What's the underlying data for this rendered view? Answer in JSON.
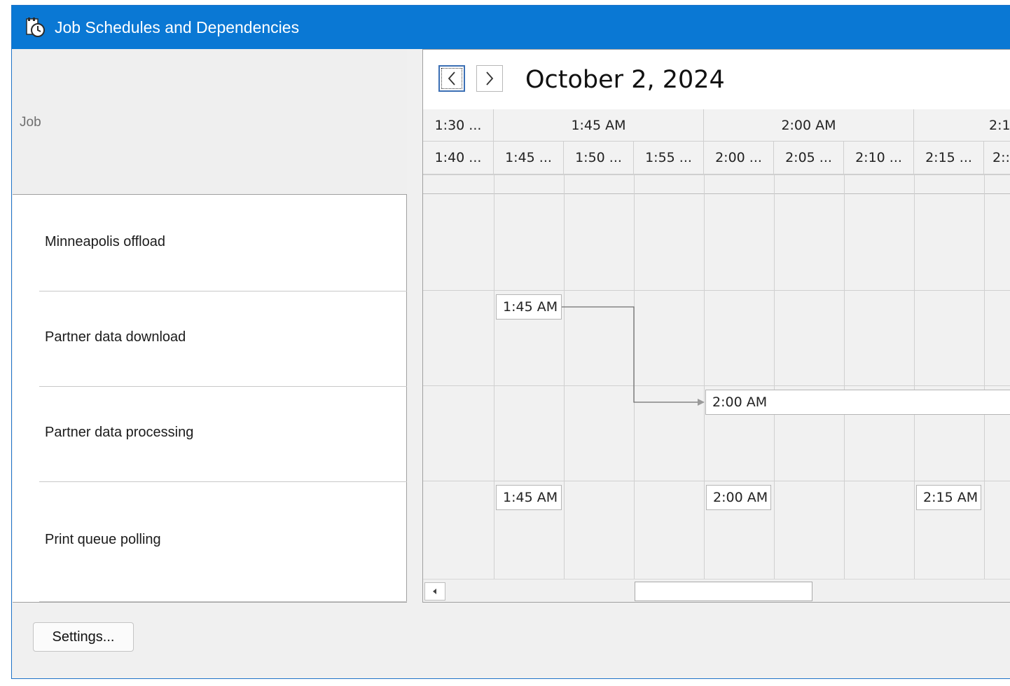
{
  "window": {
    "title": "Job Schedules and Dependencies",
    "icon": "schedule-clock-icon",
    "accent_color": "#0a78d4"
  },
  "jobs": {
    "header": "Job",
    "rows": [
      {
        "label": "Minneapolis offload"
      },
      {
        "label": "Partner data download"
      },
      {
        "label": "Partner data processing"
      },
      {
        "label": "Print queue polling"
      }
    ]
  },
  "calendar": {
    "prev_icon": "chevron-left-icon",
    "next_icon": "chevron-right-icon",
    "date": "October 2, 2024",
    "major_headers": [
      "1:30 ...",
      "1:45 AM",
      "2:00 AM",
      "2:1"
    ],
    "minor_headers": [
      "1:40 ...",
      "1:45 ...",
      "1:50 ...",
      "1:55 ...",
      "2:00 ...",
      "2:05 ...",
      "2:10 ...",
      "2:15 ...",
      "2::"
    ]
  },
  "events": {
    "download_1": "1:45 AM",
    "processing_1": "2:00 AM",
    "polling_1": "1:45 AM",
    "polling_2": "2:00 AM",
    "polling_3": "2:15 AM"
  },
  "footer": {
    "settings_label": "Settings..."
  }
}
